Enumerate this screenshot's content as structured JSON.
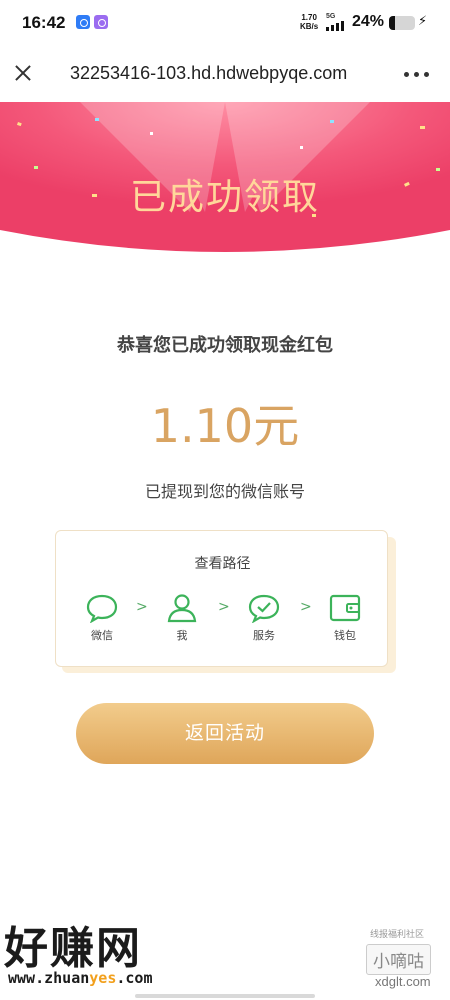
{
  "status_bar": {
    "time": "16:42",
    "net_speed_value": "1.70",
    "net_speed_unit": "KB/s",
    "network": "5G",
    "battery_percent": "24%",
    "battery_level": 0.24
  },
  "browser": {
    "url": "32253416-103.hd.hdwebpyqe.com",
    "close_icon": "close-icon",
    "more_icon": "more-icon"
  },
  "hero": {
    "title": "已成功领取"
  },
  "main": {
    "congrats_text": "恭喜您已成功领取现金红包",
    "amount": "1.10元",
    "withdraw_note": "已提现到您的微信账号"
  },
  "path_card": {
    "title": "查看路径",
    "steps": [
      {
        "label": "微信",
        "icon": "chat-bubble-icon"
      },
      {
        "label": "我",
        "icon": "user-icon"
      },
      {
        "label": "服务",
        "icon": "check-bubble-icon"
      },
      {
        "label": "钱包",
        "icon": "wallet-icon"
      }
    ],
    "separator": ">"
  },
  "button": {
    "return_label": "返回活动"
  },
  "watermarks": {
    "left_big": "好赚网",
    "left_url_prefix": "www.zhuan",
    "left_url_yes": "yes",
    "left_url_suffix": ".com",
    "right_small": "线报福利社区",
    "right_logo": "小嘀咕",
    "right_url": "xdglt.com"
  },
  "colors": {
    "hero_pink": "#f0456c",
    "gold_text": "#d9a462",
    "wechat_green": "#3cb35a",
    "button_gold": "#e8b670"
  }
}
